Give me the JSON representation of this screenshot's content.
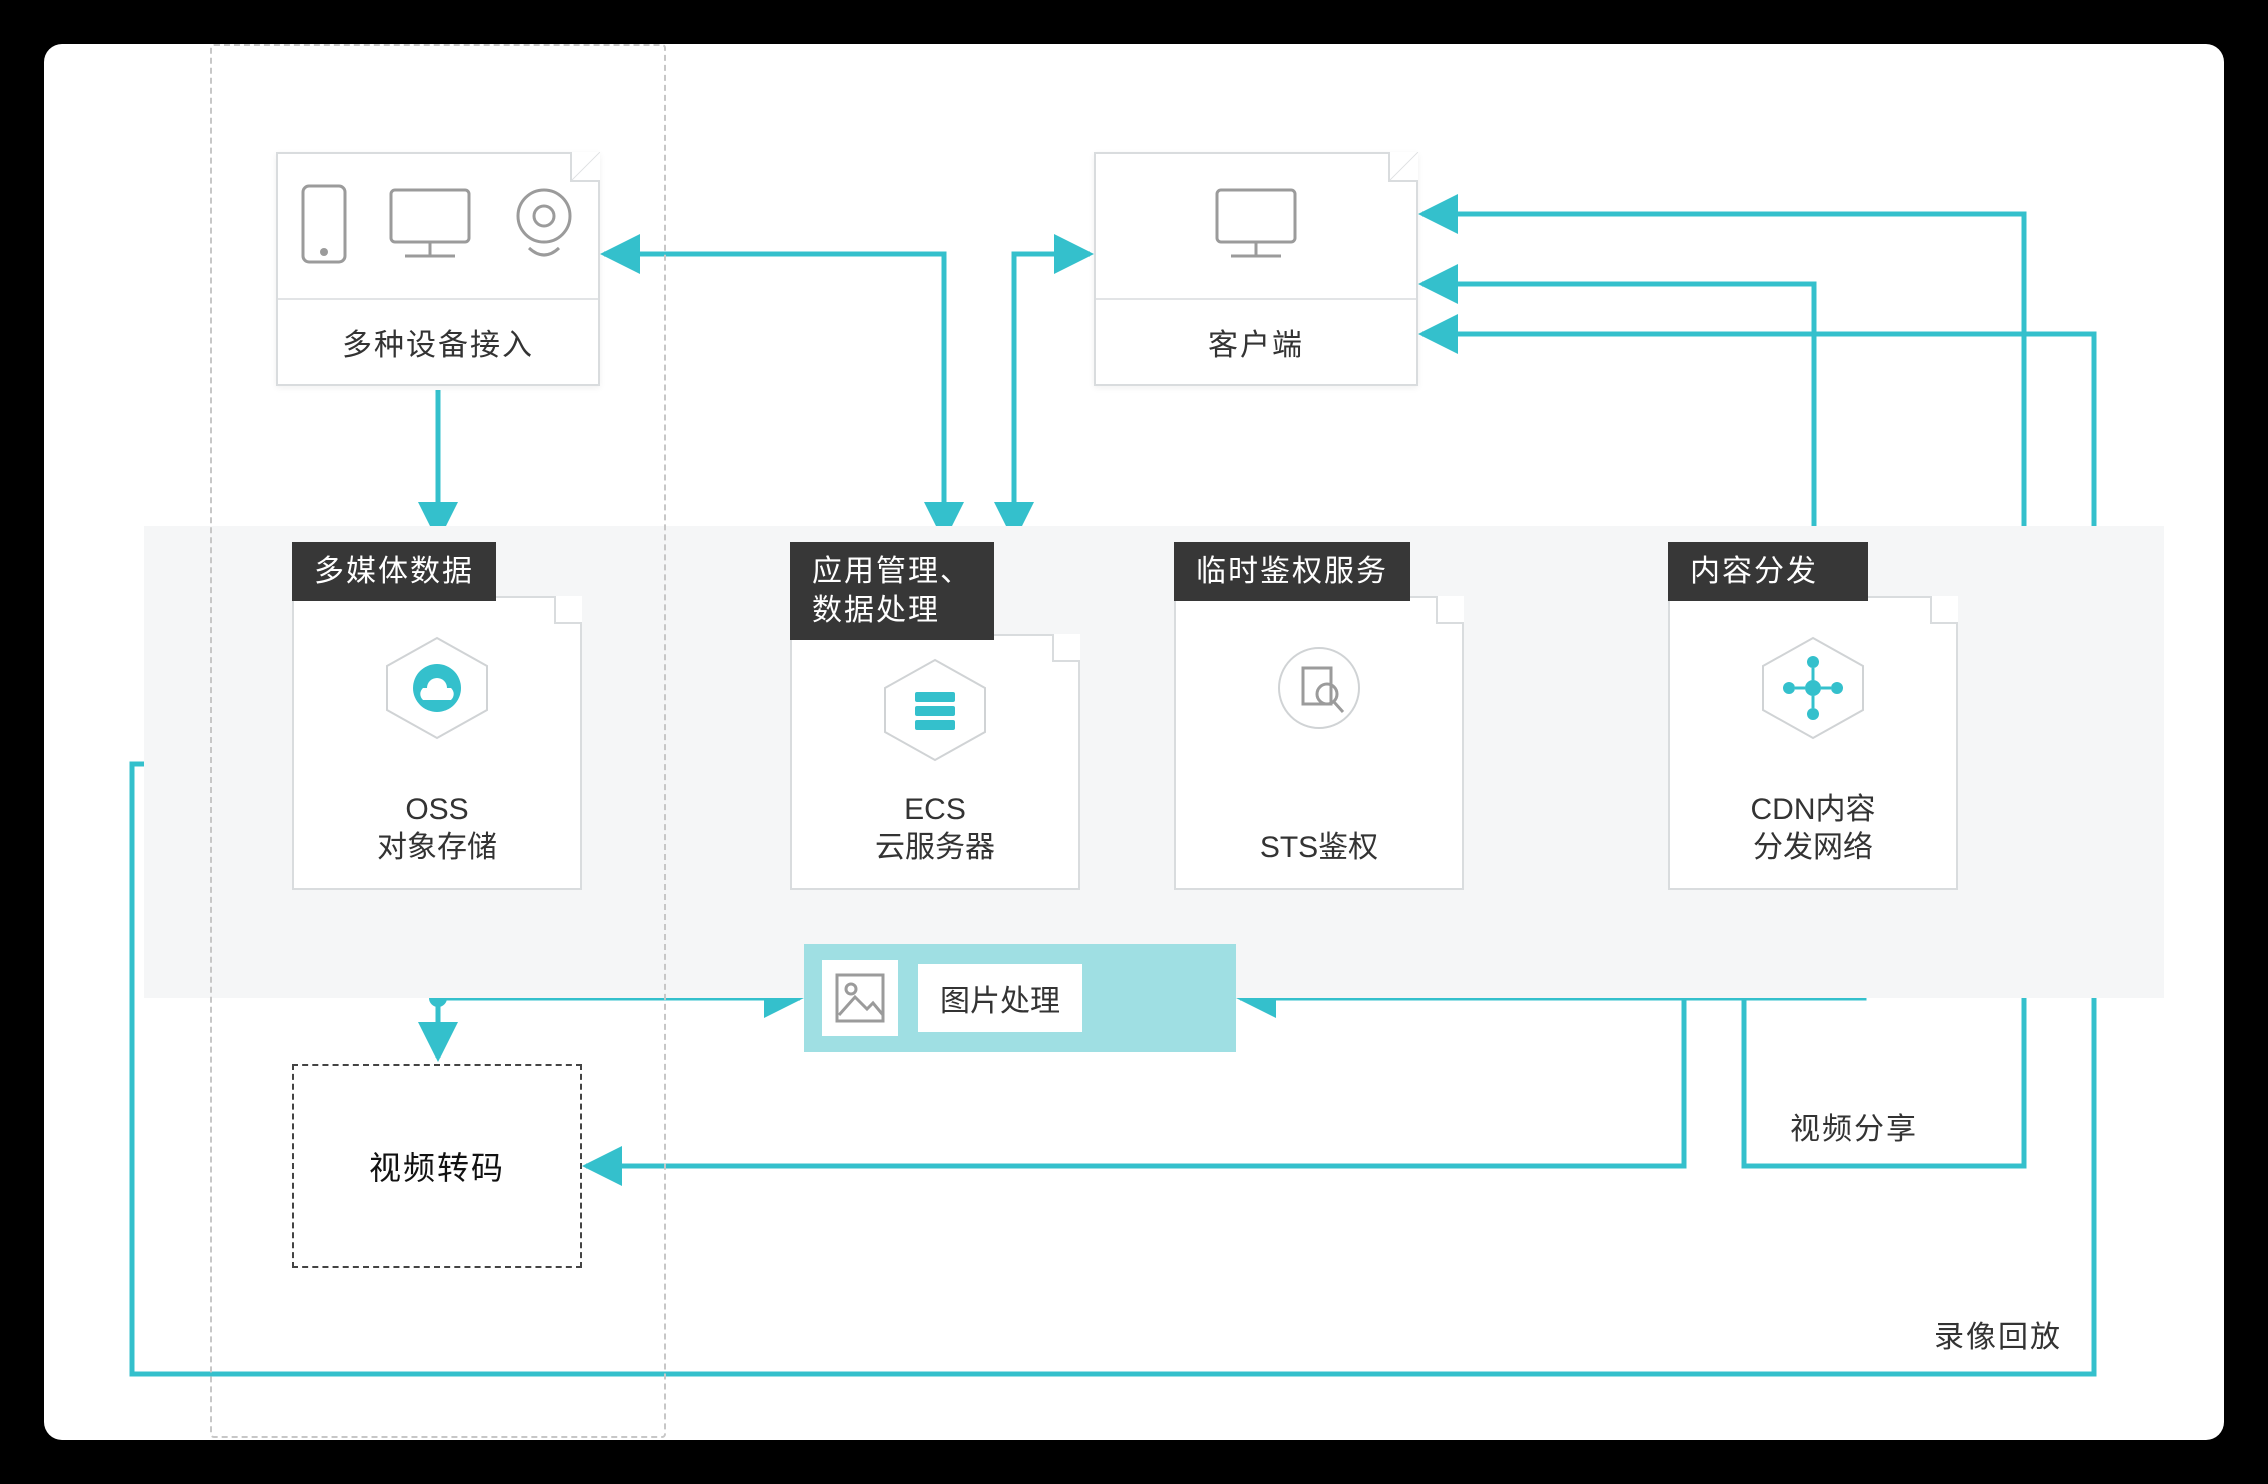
{
  "top": {
    "devices_caption": "多种设备接入",
    "client_caption": "客户端"
  },
  "services": {
    "oss": {
      "title": "多媒体数据",
      "name": "OSS",
      "sub": "对象存储"
    },
    "ecs": {
      "title": "应用管理、\n数据处理",
      "name": "ECS",
      "sub": "云服务器"
    },
    "sts": {
      "title": "临时鉴权服务",
      "name": "STS鉴权",
      "sub": ""
    },
    "cdn": {
      "title": "内容分发",
      "name": "CDN内容",
      "sub": "分发网络"
    }
  },
  "imgproc": {
    "label": "图片处理"
  },
  "transcode": {
    "label": "视频转码"
  },
  "edge_labels": {
    "video_share": "视频分享",
    "record_playback": "录像回放"
  },
  "icons": {
    "phone": "phone-icon",
    "monitor": "monitor-icon",
    "camera": "camera-icon",
    "client_monitor": "monitor-icon",
    "oss_cloud": "cloud-hex-icon",
    "ecs_server": "server-hex-icon",
    "sts_search": "search-doc-icon",
    "cdn_network": "network-hex-icon",
    "image_thumb": "image-icon"
  },
  "colors": {
    "teal": "#34c0cc",
    "gray": "#9b9b9b",
    "dark": "#373737"
  }
}
